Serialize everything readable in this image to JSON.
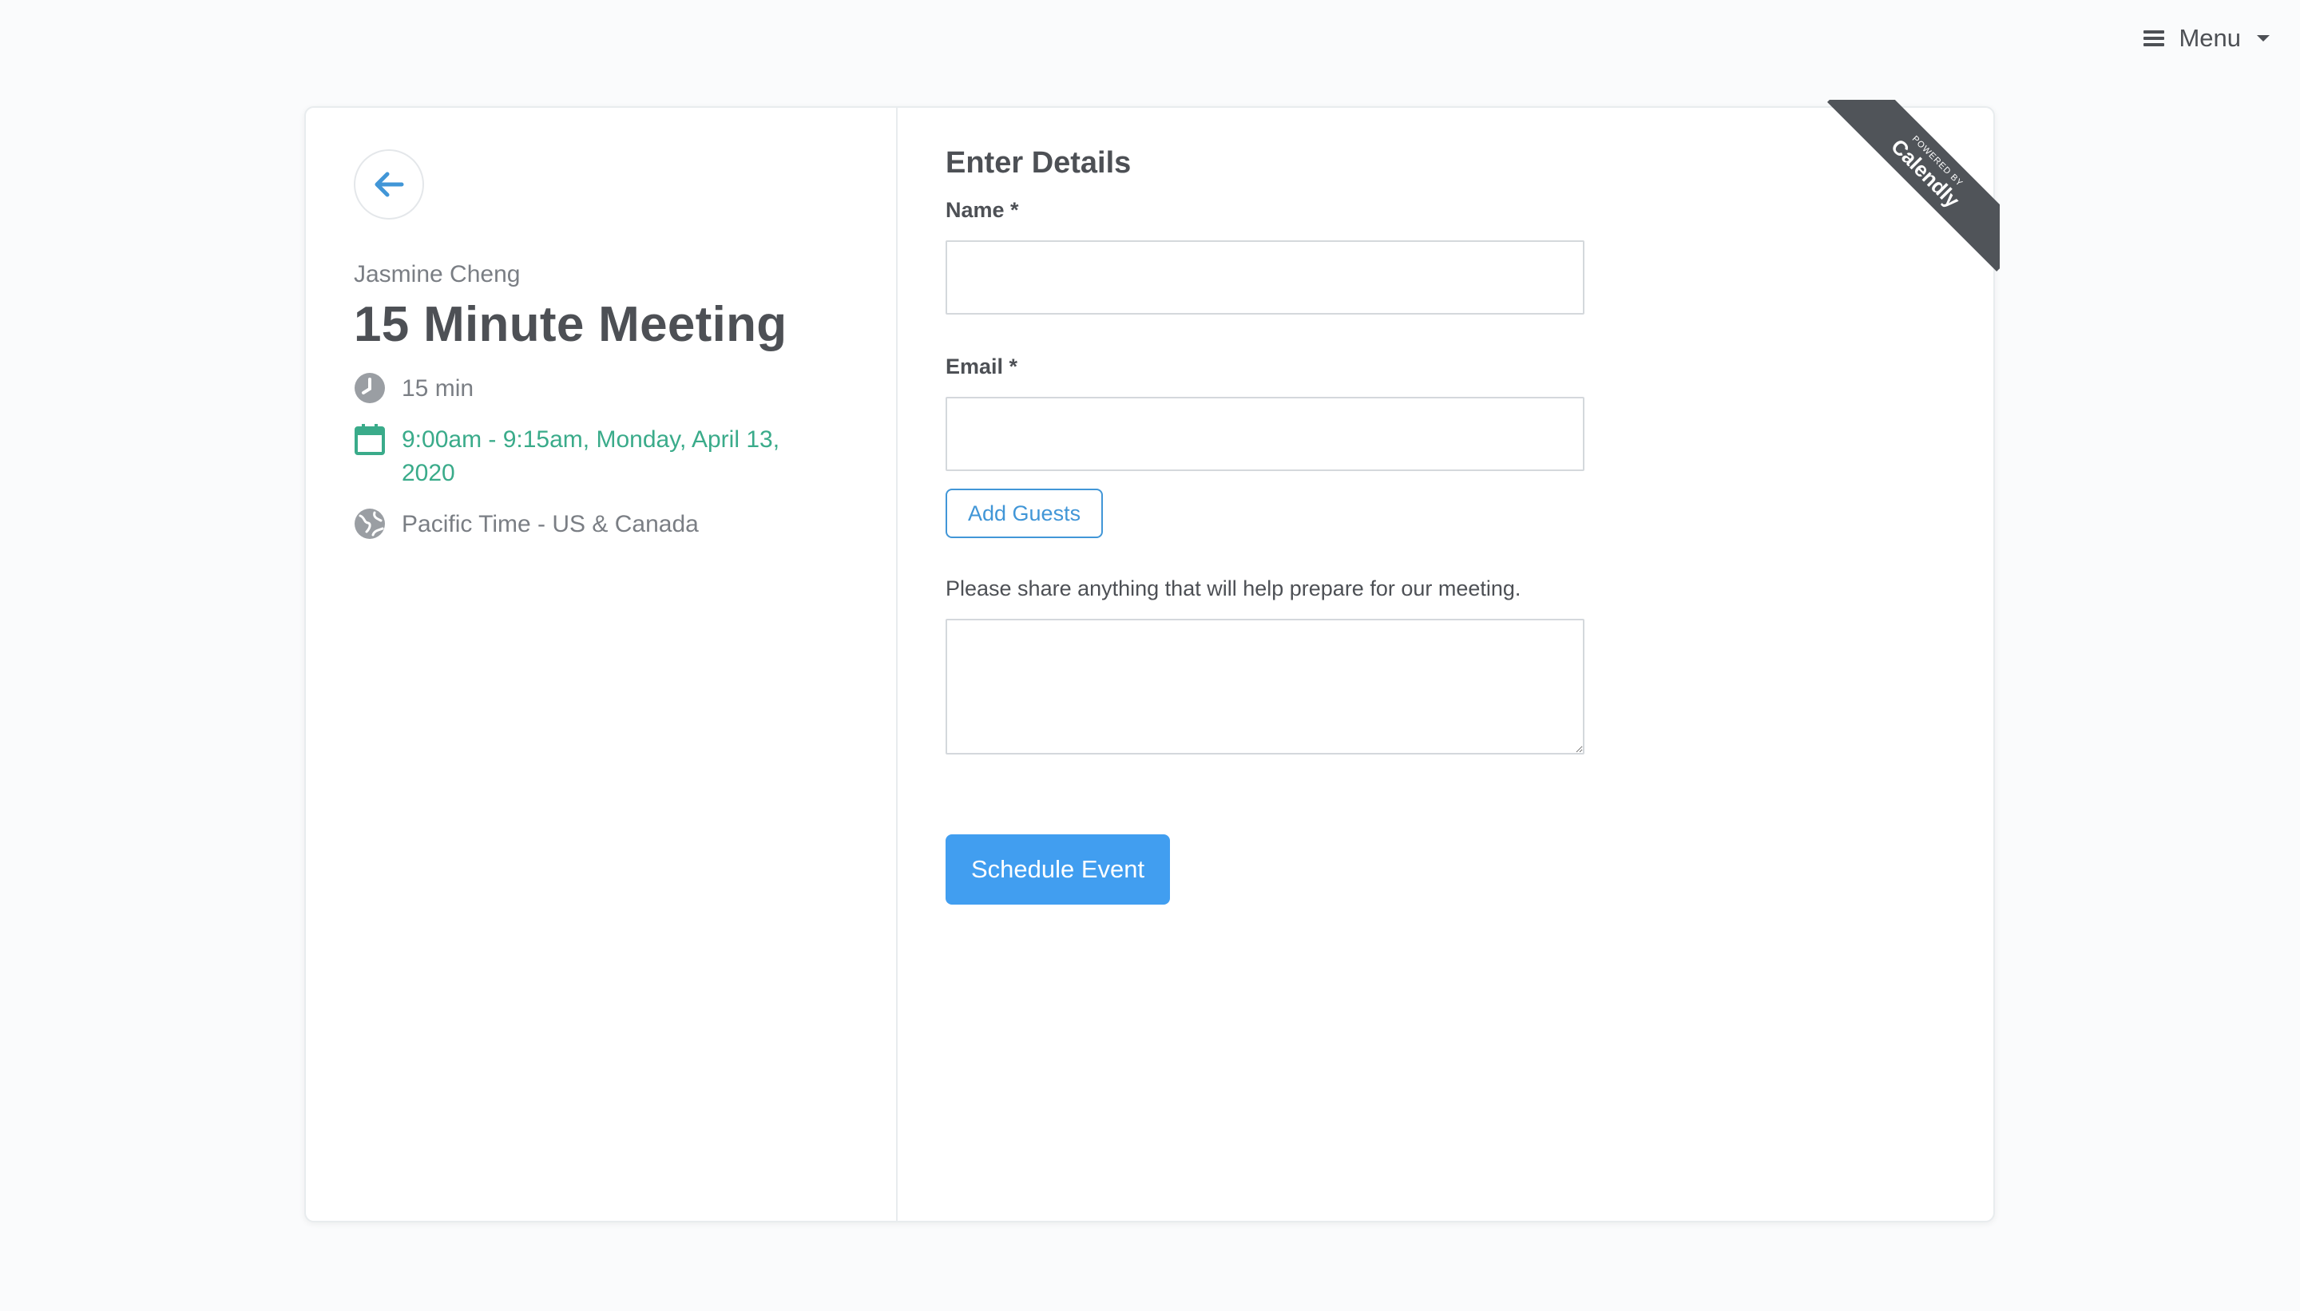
{
  "topbar": {
    "menu_label": "Menu"
  },
  "event": {
    "host_name": "Jasmine Cheng",
    "title": "15 Minute Meeting",
    "duration": "15 min",
    "datetime": "9:00am - 9:15am, Monday, April 13, 2020",
    "timezone": "Pacific Time - US & Canada"
  },
  "form": {
    "title": "Enter Details",
    "name_label": "Name *",
    "name_value": "",
    "email_label": "Email *",
    "email_value": "",
    "add_guests_label": "Add Guests",
    "notes_label": "Please share anything that will help prepare for our meeting.",
    "notes_value": "",
    "submit_label": "Schedule Event"
  },
  "ribbon": {
    "powered_by": "POWERED BY",
    "brand": "Calendly"
  },
  "colors": {
    "accent_blue": "#419ef0",
    "link_blue": "#4196d7",
    "green": "#3aab8a",
    "ribbon": "#505459"
  },
  "icons": {
    "back": "arrow-left-icon",
    "duration": "clock-icon",
    "date": "calendar-icon",
    "timezone": "globe-icon",
    "menu": "hamburger-icon"
  }
}
